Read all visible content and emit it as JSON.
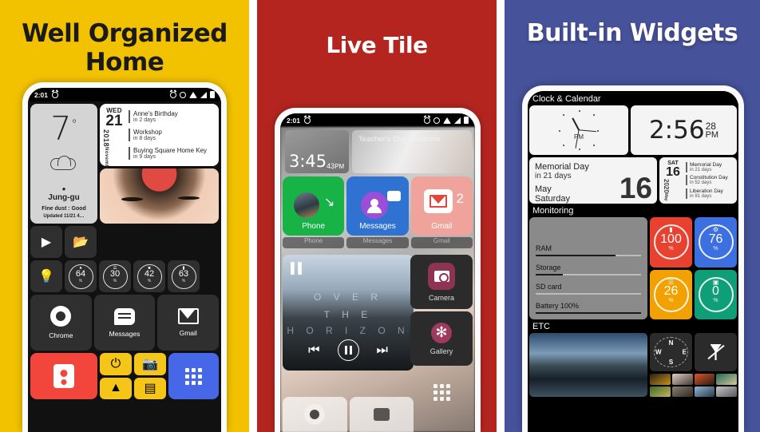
{
  "panels": [
    {
      "title": "Well Organized Home",
      "bg": "#F2C200",
      "statusbar": {
        "time": "2:01",
        "icons": [
          "alarm-icon",
          "alarm-icon",
          "gear-icon",
          "wifi-icon",
          "signal-icon",
          "battery-icon"
        ]
      },
      "weather": {
        "temp": "7",
        "degree": "°",
        "location": "Jung-gu",
        "dust": "Fine dust : Good",
        "updated": "Updated 11/21 4…"
      },
      "calendar": {
        "dow": "WED",
        "day": "21",
        "year": "2018",
        "month": "November",
        "events": [
          {
            "title": "Anne's Birthday",
            "sub": "in 2 days"
          },
          {
            "title": "Workshop",
            "sub": "in 8 days"
          },
          {
            "title": "Buying Square Home Key",
            "sub": "in 9 days"
          }
        ]
      },
      "monitors": [
        {
          "value": "64",
          "unit": "%"
        },
        {
          "value": "30",
          "unit": "%"
        },
        {
          "value": "42",
          "unit": "%"
        },
        {
          "value": "63",
          "unit": "%"
        }
      ],
      "apps": [
        {
          "label": "Chrome"
        },
        {
          "label": "Messages"
        },
        {
          "label": "Gmail"
        }
      ]
    },
    {
      "title": "Live Tile",
      "bg": "#B52520",
      "statusbar": {
        "time": "2:01"
      },
      "clock": {
        "time": "3:45",
        "seconds": "43",
        "ampm": "PM"
      },
      "note": "Teacher's Day\ntomorrow",
      "tiles": [
        {
          "label": "Phone",
          "color": "#17b347"
        },
        {
          "label": "Messages",
          "color": "#2f72d2"
        },
        {
          "label": "Gmail",
          "color": "#f0a39b",
          "badge": "2"
        }
      ],
      "ghost_labels": [
        "Phone",
        "Messages",
        "Gmail"
      ],
      "music": {
        "line1": "O V E R",
        "line2": "T H E",
        "line3": "H O R I Z O N"
      },
      "side_tiles": [
        {
          "label": "Camera"
        },
        {
          "label": "Gallery"
        }
      ]
    },
    {
      "title": "Built-in Widgets",
      "bg": "#46529A",
      "sections": {
        "clock": "Clock & Calendar",
        "monitoring": "Monitoring",
        "etc": "ETC"
      },
      "analog": {
        "ampm": "PM"
      },
      "digital": {
        "time": "2:56",
        "seconds": "28",
        "ampm": "PM"
      },
      "holiday": {
        "name": "Memorial Day",
        "sub": "in 21 days",
        "month": "May",
        "weekday": "Saturday",
        "day": "16"
      },
      "calendar2": {
        "dow": "SAT",
        "day": "16",
        "year": "2020",
        "month": "May",
        "events": [
          {
            "title": "Memorial Day",
            "sub": "in 21 days"
          },
          {
            "title": "Constitution Day",
            "sub": "in 52 days"
          },
          {
            "title": "Liberation Day",
            "sub": "in 91 days"
          }
        ]
      },
      "bars": [
        {
          "label": "RAM",
          "pct": 76
        },
        {
          "label": "Storage",
          "pct": 26
        },
        {
          "label": "SD card",
          "pct": 0
        },
        {
          "label": "Battery 100%",
          "pct": 100
        }
      ],
      "monitors": [
        {
          "value": "100",
          "unit": "%",
          "color": "#e8412f",
          "icon": "battery-icon"
        },
        {
          "value": "76",
          "unit": "%",
          "color": "#3c6fe0",
          "icon": "gear-icon"
        },
        {
          "value": "26",
          "unit": "%",
          "color": "#f2a100",
          "icon": "storage-icon"
        },
        {
          "value": "0",
          "unit": "%",
          "color": "#0e9e78",
          "icon": "sdcard-icon"
        }
      ],
      "compass": {
        "n": "N",
        "e": "E",
        "s": "S",
        "w": "W"
      }
    }
  ]
}
